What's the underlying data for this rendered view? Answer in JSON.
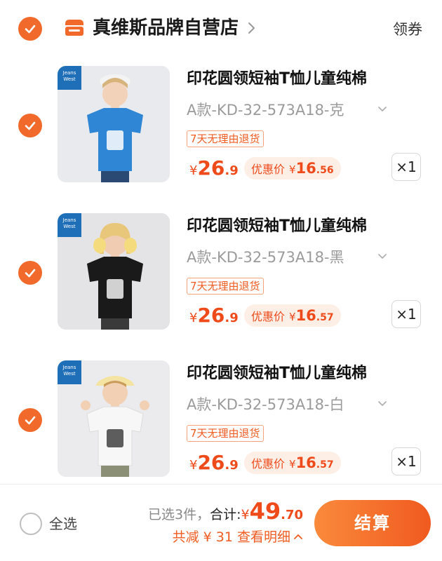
{
  "store": {
    "name": "真维斯品牌自营店",
    "coupon_label": "领券"
  },
  "items": [
    {
      "title": "印花圆领短袖T恤儿童纯棉",
      "variant": "A款-KD-32-573A18-克",
      "tag": "7天无理由退货",
      "price_symbol": "¥",
      "price_int": "26",
      "price_dec": ".9",
      "promo_label": "优惠价",
      "promo_symbol": "¥",
      "promo_int": "16",
      "promo_dec": ".56",
      "qty": "×1",
      "shirt_color": "#2e86d4",
      "brand_badge": "Jeans West 真维斯"
    },
    {
      "title": "印花圆领短袖T恤儿童纯棉",
      "variant": "A款-KD-32-573A18-黑",
      "tag": "7天无理由退货",
      "price_symbol": "¥",
      "price_int": "26",
      "price_dec": ".9",
      "promo_label": "优惠价",
      "promo_symbol": "¥",
      "promo_int": "16",
      "promo_dec": ".57",
      "qty": "×1",
      "shirt_color": "#1a1a1a",
      "brand_badge": "Jeans West 真维斯"
    },
    {
      "title": "印花圆领短袖T恤儿童纯棉",
      "variant": "A款-KD-32-573A18-白",
      "tag": "7天无理由退货",
      "price_symbol": "¥",
      "price_int": "26",
      "price_dec": ".9",
      "promo_label": "优惠价",
      "promo_symbol": "¥",
      "promo_int": "16",
      "promo_dec": ".57",
      "qty": "×1",
      "shirt_color": "#f7f7f7",
      "brand_badge": "Jeans West 真维斯"
    }
  ],
  "footer": {
    "select_all_label": "全选",
    "selected_count": "已选3件，",
    "total_label": "合计:",
    "total_symbol": "¥",
    "total_int": "49",
    "total_dec": ".70",
    "discount_text": "共减 ¥ 31  查看明细",
    "checkout_label": "结算"
  },
  "colors": {
    "accent": "#f26a2b",
    "price": "#ef4a1a",
    "promo_bg": "#fdeee6"
  },
  "icons": {
    "check": "checkmark-icon",
    "store": "store-icon",
    "chevron": "chevron-right-icon",
    "dropdown": "chevron-down-icon",
    "detail": "chevron-up-icon"
  }
}
